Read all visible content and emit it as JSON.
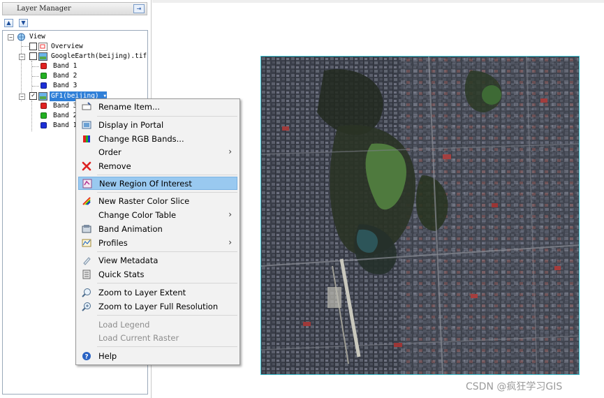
{
  "layer_manager": {
    "title": "Layer Manager",
    "dock_icon": "dock-icon",
    "up_icon": "up-arrow-icon",
    "down_icon": "down-arrow-icon"
  },
  "tree": {
    "root": "View",
    "overview": "Overview",
    "layer1": {
      "name": "GoogleEarth(beijing).tif",
      "checked": false,
      "bands": [
        "Band 1",
        "Band 2",
        "Band 3"
      ]
    },
    "layer2": {
      "name": "GF1(beijing)",
      "checked": true,
      "checkmark": "✓",
      "bands": [
        "Band 3",
        "Band 2",
        "Band 1"
      ]
    }
  },
  "band_colors": {
    "red": "#e02020",
    "green": "#22b022",
    "blue": "#1c2fd6"
  },
  "context_menu": {
    "items": [
      {
        "label": "Rename Item...",
        "icon": "rename-icon"
      },
      {
        "label": "Display in Portal",
        "icon": "portal-icon"
      },
      {
        "label": "Change RGB Bands...",
        "icon": "rgb-bands-icon"
      },
      {
        "label": "Order",
        "submenu": "›"
      },
      {
        "label": "Remove",
        "icon": "remove-x-icon"
      },
      {
        "label": "New Region Of Interest",
        "icon": "roi-icon",
        "highlighted": true
      },
      {
        "label": "New Raster Color Slice",
        "icon": "color-slice-icon"
      },
      {
        "label": "Change Color Table",
        "submenu": "›"
      },
      {
        "label": "Band Animation",
        "icon": "animation-icon"
      },
      {
        "label": "Profiles",
        "icon": "profiles-icon",
        "submenu": "›"
      },
      {
        "label": "View Metadata",
        "icon": "metadata-icon"
      },
      {
        "label": "Quick Stats",
        "icon": "stats-icon"
      },
      {
        "label": "Zoom to Layer Extent",
        "icon": "zoom-extent-icon"
      },
      {
        "label": "Zoom to Layer Full Resolution",
        "icon": "zoom-full-icon"
      },
      {
        "label": "Load Legend",
        "disabled": true
      },
      {
        "label": "Load Current Raster",
        "disabled": true
      },
      {
        "label": "Help",
        "icon": "help-icon"
      }
    ],
    "highlight_color": "#99c9f0"
  },
  "watermark": "CSDN @疯狂学习GIS",
  "image_frame_color": "#3ec7d6"
}
